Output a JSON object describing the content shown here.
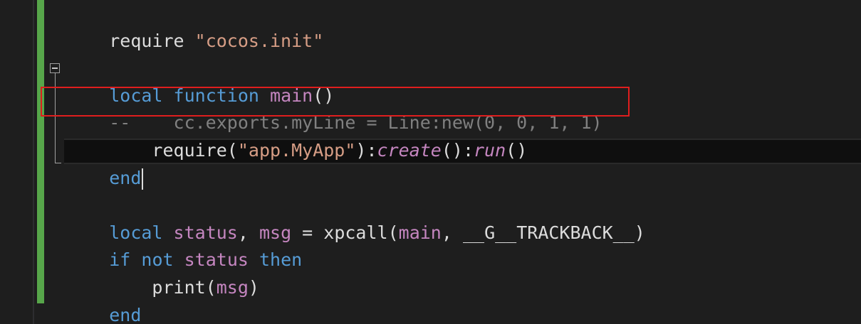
{
  "code": {
    "line1": {
      "t1": "require ",
      "t2": "\"cocos.init\""
    },
    "line3": {
      "t1": "local",
      "t2": " ",
      "t3": "function",
      "t4": " ",
      "t5": "main",
      "t6": "()"
    },
    "line4": {
      "comment": "--    cc.exports.myLine = Line:new(0, 0, 1, 1)"
    },
    "line5": {
      "t1": "    require(",
      "t2": "\"app.MyApp\"",
      "t3": "):",
      "t4": "create",
      "t5": "():",
      "t6": "run",
      "t7": "()"
    },
    "line6": {
      "t1": "end"
    },
    "line8": {
      "t1": "local",
      "t2": " ",
      "t3": "status",
      "t4": ", ",
      "t5": "msg",
      "t6": " = xpcall(",
      "t7": "main",
      "t8": ", __G__TRACKBACK__)"
    },
    "line9": {
      "t1": "if",
      "t2": " ",
      "t3": "not",
      "t4": " ",
      "t5": "status",
      "t6": " ",
      "t7": "then"
    },
    "line10": {
      "t1": "    print(",
      "t2": "msg",
      "t3": ")"
    },
    "line11": {
      "t1": "end"
    }
  },
  "colors": {
    "background": "#1e1e1e",
    "keyword": "#569cd6",
    "identifier": "#c586c0",
    "string": "#d69d85",
    "comment": "#808080",
    "change_bar": "#57a64a",
    "annotation_box": "#e01e1e"
  },
  "icons": {
    "fold": "collapse-minus-icon"
  }
}
